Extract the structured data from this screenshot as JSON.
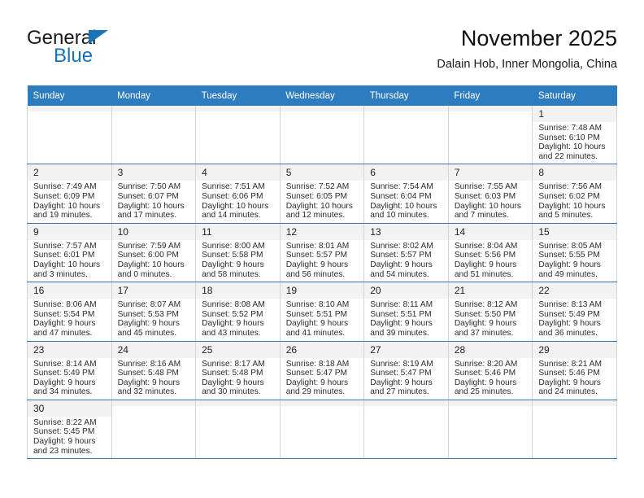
{
  "brand": {
    "name_part1": "General",
    "name_part2": "Blue",
    "flag_icon": "blue-triangle-flag-icon"
  },
  "header": {
    "title": "November 2025",
    "subtitle": "Dalain Hob, Inner Mongolia, China"
  },
  "colors": {
    "header_bar": "#2d7cc0",
    "brand_blue": "#1574bb",
    "day_number_bg": "#f2f2f2",
    "row_separator": "#3c73b4"
  },
  "calendar": {
    "weekday_headers": [
      "Sunday",
      "Monday",
      "Tuesday",
      "Wednesday",
      "Thursday",
      "Friday",
      "Saturday"
    ],
    "labels": {
      "sunrise": "Sunrise:",
      "sunset": "Sunset:",
      "daylight": "Daylight:"
    },
    "weeks": [
      [
        {
          "day": "",
          "empty": true
        },
        {
          "day": "",
          "empty": true
        },
        {
          "day": "",
          "empty": true
        },
        {
          "day": "",
          "empty": true
        },
        {
          "day": "",
          "empty": true
        },
        {
          "day": "",
          "empty": true
        },
        {
          "day": "1",
          "sunrise": "Sunrise: 7:48 AM",
          "sunset": "Sunset: 6:10 PM",
          "daylight": "Daylight: 10 hours and 22 minutes."
        }
      ],
      [
        {
          "day": "2",
          "sunrise": "Sunrise: 7:49 AM",
          "sunset": "Sunset: 6:09 PM",
          "daylight": "Daylight: 10 hours and 19 minutes."
        },
        {
          "day": "3",
          "sunrise": "Sunrise: 7:50 AM",
          "sunset": "Sunset: 6:07 PM",
          "daylight": "Daylight: 10 hours and 17 minutes."
        },
        {
          "day": "4",
          "sunrise": "Sunrise: 7:51 AM",
          "sunset": "Sunset: 6:06 PM",
          "daylight": "Daylight: 10 hours and 14 minutes."
        },
        {
          "day": "5",
          "sunrise": "Sunrise: 7:52 AM",
          "sunset": "Sunset: 6:05 PM",
          "daylight": "Daylight: 10 hours and 12 minutes."
        },
        {
          "day": "6",
          "sunrise": "Sunrise: 7:54 AM",
          "sunset": "Sunset: 6:04 PM",
          "daylight": "Daylight: 10 hours and 10 minutes."
        },
        {
          "day": "7",
          "sunrise": "Sunrise: 7:55 AM",
          "sunset": "Sunset: 6:03 PM",
          "daylight": "Daylight: 10 hours and 7 minutes."
        },
        {
          "day": "8",
          "sunrise": "Sunrise: 7:56 AM",
          "sunset": "Sunset: 6:02 PM",
          "daylight": "Daylight: 10 hours and 5 minutes."
        }
      ],
      [
        {
          "day": "9",
          "sunrise": "Sunrise: 7:57 AM",
          "sunset": "Sunset: 6:01 PM",
          "daylight": "Daylight: 10 hours and 3 minutes."
        },
        {
          "day": "10",
          "sunrise": "Sunrise: 7:59 AM",
          "sunset": "Sunset: 6:00 PM",
          "daylight": "Daylight: 10 hours and 0 minutes."
        },
        {
          "day": "11",
          "sunrise": "Sunrise: 8:00 AM",
          "sunset": "Sunset: 5:58 PM",
          "daylight": "Daylight: 9 hours and 58 minutes."
        },
        {
          "day": "12",
          "sunrise": "Sunrise: 8:01 AM",
          "sunset": "Sunset: 5:57 PM",
          "daylight": "Daylight: 9 hours and 56 minutes."
        },
        {
          "day": "13",
          "sunrise": "Sunrise: 8:02 AM",
          "sunset": "Sunset: 5:57 PM",
          "daylight": "Daylight: 9 hours and 54 minutes."
        },
        {
          "day": "14",
          "sunrise": "Sunrise: 8:04 AM",
          "sunset": "Sunset: 5:56 PM",
          "daylight": "Daylight: 9 hours and 51 minutes."
        },
        {
          "day": "15",
          "sunrise": "Sunrise: 8:05 AM",
          "sunset": "Sunset: 5:55 PM",
          "daylight": "Daylight: 9 hours and 49 minutes."
        }
      ],
      [
        {
          "day": "16",
          "sunrise": "Sunrise: 8:06 AM",
          "sunset": "Sunset: 5:54 PM",
          "daylight": "Daylight: 9 hours and 47 minutes."
        },
        {
          "day": "17",
          "sunrise": "Sunrise: 8:07 AM",
          "sunset": "Sunset: 5:53 PM",
          "daylight": "Daylight: 9 hours and 45 minutes."
        },
        {
          "day": "18",
          "sunrise": "Sunrise: 8:08 AM",
          "sunset": "Sunset: 5:52 PM",
          "daylight": "Daylight: 9 hours and 43 minutes."
        },
        {
          "day": "19",
          "sunrise": "Sunrise: 8:10 AM",
          "sunset": "Sunset: 5:51 PM",
          "daylight": "Daylight: 9 hours and 41 minutes."
        },
        {
          "day": "20",
          "sunrise": "Sunrise: 8:11 AM",
          "sunset": "Sunset: 5:51 PM",
          "daylight": "Daylight: 9 hours and 39 minutes."
        },
        {
          "day": "21",
          "sunrise": "Sunrise: 8:12 AM",
          "sunset": "Sunset: 5:50 PM",
          "daylight": "Daylight: 9 hours and 37 minutes."
        },
        {
          "day": "22",
          "sunrise": "Sunrise: 8:13 AM",
          "sunset": "Sunset: 5:49 PM",
          "daylight": "Daylight: 9 hours and 36 minutes."
        }
      ],
      [
        {
          "day": "23",
          "sunrise": "Sunrise: 8:14 AM",
          "sunset": "Sunset: 5:49 PM",
          "daylight": "Daylight: 9 hours and 34 minutes."
        },
        {
          "day": "24",
          "sunrise": "Sunrise: 8:16 AM",
          "sunset": "Sunset: 5:48 PM",
          "daylight": "Daylight: 9 hours and 32 minutes."
        },
        {
          "day": "25",
          "sunrise": "Sunrise: 8:17 AM",
          "sunset": "Sunset: 5:48 PM",
          "daylight": "Daylight: 9 hours and 30 minutes."
        },
        {
          "day": "26",
          "sunrise": "Sunrise: 8:18 AM",
          "sunset": "Sunset: 5:47 PM",
          "daylight": "Daylight: 9 hours and 29 minutes."
        },
        {
          "day": "27",
          "sunrise": "Sunrise: 8:19 AM",
          "sunset": "Sunset: 5:47 PM",
          "daylight": "Daylight: 9 hours and 27 minutes."
        },
        {
          "day": "28",
          "sunrise": "Sunrise: 8:20 AM",
          "sunset": "Sunset: 5:46 PM",
          "daylight": "Daylight: 9 hours and 25 minutes."
        },
        {
          "day": "29",
          "sunrise": "Sunrise: 8:21 AM",
          "sunset": "Sunset: 5:46 PM",
          "daylight": "Daylight: 9 hours and 24 minutes."
        }
      ],
      [
        {
          "day": "30",
          "sunrise": "Sunrise: 8:22 AM",
          "sunset": "Sunset: 5:45 PM",
          "daylight": "Daylight: 9 hours and 23 minutes."
        },
        {
          "day": "",
          "empty": true
        },
        {
          "day": "",
          "empty": true
        },
        {
          "day": "",
          "empty": true
        },
        {
          "day": "",
          "empty": true
        },
        {
          "day": "",
          "empty": true
        },
        {
          "day": "",
          "empty": true
        }
      ]
    ]
  }
}
